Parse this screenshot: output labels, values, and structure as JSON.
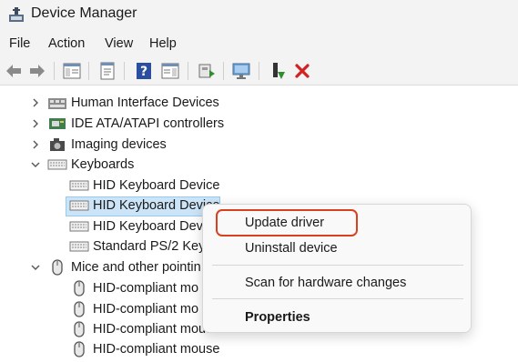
{
  "window": {
    "title": "Device Manager"
  },
  "menu": {
    "items": [
      "File",
      "Action",
      "View",
      "Help"
    ]
  },
  "toolbar": {
    "icons": [
      "back-arrow-icon",
      "forward-arrow-icon",
      "show-hide-tree-icon",
      "properties-icon",
      "help-icon",
      "action-pane-icon",
      "update-driver-icon",
      "scan-hardware-icon",
      "enable-device-icon",
      "uninstall-device-icon"
    ],
    "uninstall_color": "#d42020",
    "enable_color": "#2f8f2f"
  },
  "tree": {
    "rows": [
      {
        "label": "Human Interface Devices",
        "expander": "collapsed",
        "icon": "hid-icon"
      },
      {
        "label": "IDE ATA/ATAPI controllers",
        "expander": "collapsed",
        "icon": "ide-controller-icon"
      },
      {
        "label": "Imaging devices",
        "expander": "collapsed",
        "icon": "camera-icon"
      },
      {
        "label": "Keyboards",
        "expander": "expanded",
        "icon": "keyboard-icon"
      },
      {
        "label": "HID Keyboard Device",
        "expander": "none",
        "icon": "keyboard-icon"
      },
      {
        "label": "HID Keyboard Device",
        "expander": "none",
        "icon": "keyboard-icon",
        "selected": true
      },
      {
        "label": "HID Keyboard Dev",
        "expander": "none",
        "icon": "keyboard-icon"
      },
      {
        "label": "Standard PS/2 Keyb",
        "expander": "none",
        "icon": "keyboard-icon"
      },
      {
        "label": "Mice and other pointin",
        "expander": "expanded",
        "icon": "mouse-icon"
      },
      {
        "label": "HID-compliant mo",
        "expander": "none",
        "icon": "mouse-icon"
      },
      {
        "label": "HID-compliant mo",
        "expander": "none",
        "icon": "mouse-icon"
      },
      {
        "label": "HID-compliant mouse",
        "expander": "none",
        "icon": "mouse-icon"
      },
      {
        "label": "HID-compliant mouse",
        "expander": "none",
        "icon": "mouse-icon"
      }
    ]
  },
  "context_menu": {
    "items": [
      {
        "label": "Update driver",
        "highlighted": true
      },
      {
        "label": "Uninstall device"
      },
      {
        "label": "Scan for hardware changes"
      },
      {
        "label": "Properties",
        "bold": true
      }
    ],
    "highlight_color": "#d9401e"
  }
}
